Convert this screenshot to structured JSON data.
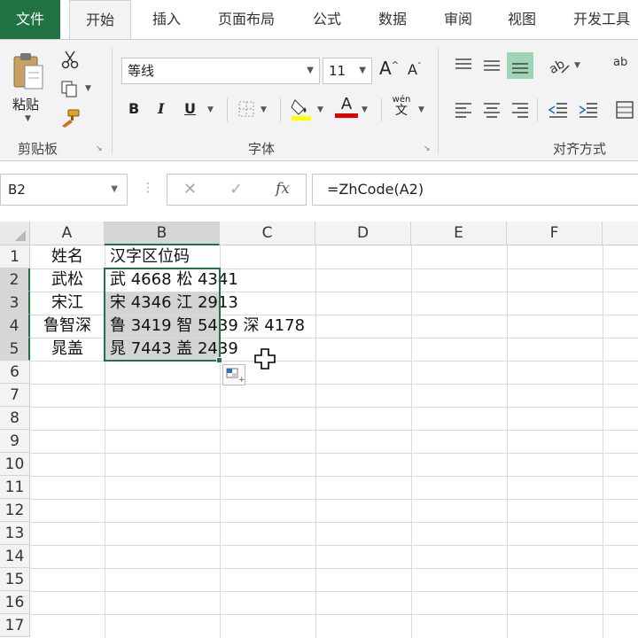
{
  "tabs": [
    "文件",
    "开始",
    "插入",
    "页面布局",
    "公式",
    "数据",
    "审阅",
    "视图",
    "开发工具"
  ],
  "active_tab_index": 1,
  "ribbon": {
    "clipboard": {
      "paste_label": "粘贴",
      "group_label": "剪贴板"
    },
    "font": {
      "font_name": "等线",
      "font_size": "11",
      "grow_label": "A",
      "shrink_label": "A",
      "bold": "B",
      "italic": "I",
      "underline": "U",
      "font_color_label": "A",
      "phonetic_top": "wén",
      "phonetic_bottom": "文",
      "group_label": "字体"
    },
    "alignment": {
      "wrap_label": "ab",
      "group_label": "对齐方式"
    }
  },
  "formula_bar": {
    "name_box": "B2",
    "cancel": "✕",
    "enter": "✓",
    "fx": "fx",
    "formula": "=ZhCode(A2)"
  },
  "sheet": {
    "columns": [
      "A",
      "B",
      "C",
      "D",
      "E",
      "F"
    ],
    "rows": [
      "1",
      "2",
      "3",
      "4",
      "5",
      "6",
      "7",
      "8",
      "9",
      "10",
      "11",
      "12",
      "13",
      "14",
      "15",
      "16",
      "17"
    ],
    "cells": {
      "A1": "姓名",
      "B1": "汉字区位码",
      "A2": "武松",
      "B2": "武 4668 松 4341",
      "A3": "宋江",
      "B3": "宋 4346 江 2913",
      "A4": "鲁智深",
      "B4": "鲁 3419 智 5439 深 4178",
      "A5": "晁盖",
      "B5": "晁 7443 盖 2439"
    },
    "selected_range": "B2:B5"
  },
  "colors": {
    "accent": "#217346",
    "selection_fill": "#d4d4d4",
    "highlight_yellow": "#ffff00",
    "font_red": "#e00000"
  }
}
